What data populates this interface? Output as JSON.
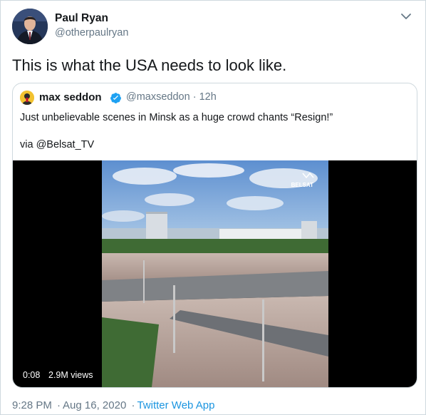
{
  "author": {
    "name": "Paul Ryan",
    "handle": "@otherpaulryan",
    "avatar_icon": "profile-photo"
  },
  "tweet": {
    "text": "This is what the USA needs to look like."
  },
  "quoted_tweet": {
    "name": "max seddon",
    "verified": true,
    "handle": "@maxseddon",
    "time": "12h",
    "separator": "·",
    "text": "Just unbelievable scenes in Minsk as a huge crowd chants “Resign!”",
    "via": "via @Belsat_TV",
    "video": {
      "elapsed": "0:08",
      "views": "2.9M views",
      "watermark": "BELSAT"
    }
  },
  "footer": {
    "time": "9:28 PM",
    "separator": "·",
    "date": "Aug 16, 2020",
    "source": "Twitter Web App"
  },
  "colors": {
    "link": "#1b95e0",
    "secondary_text": "#657786",
    "border": "#cfd9de",
    "verified": "#1da1f2"
  }
}
